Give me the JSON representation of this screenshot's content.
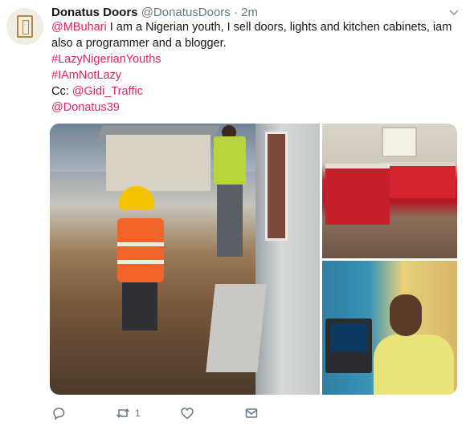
{
  "author": {
    "name": "Donatus Doors",
    "handle": "@DonatusDoors",
    "separator": "·",
    "time": "2m",
    "avatar_icon": "donatus-doors-logo"
  },
  "tweet": {
    "mention_mbuhari": "@MBuhari",
    "body_line1": " I am a Nigerian youth, I sell doors, lights and kitchen cabinets, iam",
    "body_line2": "also a  programmer and a blogger.",
    "hashtag1": "#LazyNigerianYouths",
    "hashtag2": "#IAmNotLazy",
    "cc_label": "Cc: ",
    "mention_gidi": "@Gidi_Traffic",
    "mention_donatus": "@Donatus39"
  },
  "media": {
    "images": [
      "construction-site-photo",
      "red-kitchen-cabinets-photo",
      "selfie-with-laptop-photo"
    ]
  },
  "actions": {
    "reply_icon": "reply-icon",
    "retweet_icon": "retweet-icon",
    "retweet_count": "1",
    "like_icon": "heart-icon",
    "dm_icon": "envelope-icon"
  },
  "colors": {
    "link": "#e0245e",
    "muted": "#657786",
    "text": "#14171a"
  }
}
